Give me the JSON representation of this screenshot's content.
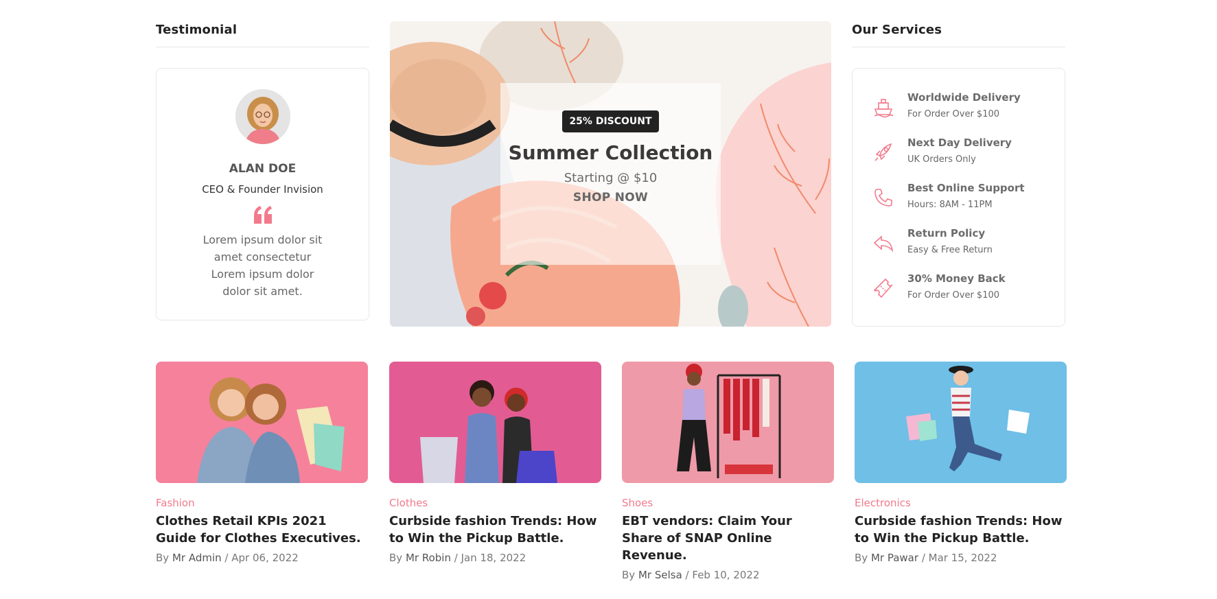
{
  "testimonial": {
    "heading": "Testimonial",
    "name": "ALAN DOE",
    "role": "CEO & Founder Invision",
    "text": "Lorem ipsum dolor sit amet consectetur Lorem ipsum dolor dolor sit amet."
  },
  "banner": {
    "badge": "25% DISCOUNT",
    "title": "Summer Collection",
    "subtitle": "Starting @ $10",
    "cta": "SHOP NOW"
  },
  "services": {
    "heading": "Our Services",
    "items": [
      {
        "icon": "ship-icon",
        "name": "Worldwide Delivery",
        "detail": "For Order Over $100"
      },
      {
        "icon": "rocket-icon",
        "name": "Next Day Delivery",
        "detail": "UK Orders Only"
      },
      {
        "icon": "phone-icon",
        "name": "Best Online Support",
        "detail": "Hours: 8AM - 11PM"
      },
      {
        "icon": "return-arrow-icon",
        "name": "Return Policy",
        "detail": "Easy & Free Return"
      },
      {
        "icon": "ticket-icon",
        "name": "30% Money Back",
        "detail": "For Order Over $100"
      }
    ]
  },
  "posts": [
    {
      "category": "Fashion",
      "title": "Clothes Retail KPIs 2021 Guide for Clothes Executives.",
      "by_label": "By",
      "author": "Mr Admin",
      "date": "Apr 06, 2022"
    },
    {
      "category": "Clothes",
      "title": "Curbside fashion Trends: How to Win the Pickup Battle.",
      "by_label": "By",
      "author": "Mr Robin",
      "date": "Jan 18, 2022"
    },
    {
      "category": "Shoes",
      "title": "EBT vendors: Claim Your Share of SNAP Online Revenue.",
      "by_label": "By",
      "author": "Mr Selsa",
      "date": "Feb 10, 2022"
    },
    {
      "category": "Electronics",
      "title": "Curbside fashion Trends: How to Win the Pickup Battle.",
      "by_label": "By",
      "author": "Mr Pawar",
      "date": "Mar 15, 2022"
    }
  ],
  "colors": {
    "accent_pink": "#f27a8c",
    "badge_bg": "#222222"
  }
}
